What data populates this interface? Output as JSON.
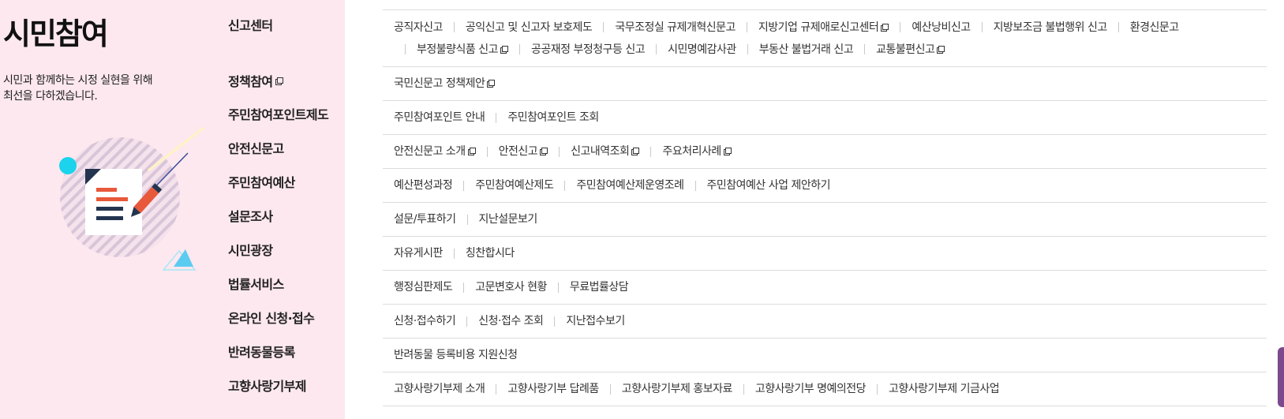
{
  "intro": {
    "title": "시민참여",
    "desc_line1": "시민과 함께하는 시정 실현을 위해",
    "desc_line2": "최선을 다하겠습니다."
  },
  "menu": [
    {
      "category": "신고센터",
      "category_external": false,
      "links": [
        {
          "label": "공직자신고",
          "external": false
        },
        {
          "label": "공익신고 및 신고자 보호제도",
          "external": false
        },
        {
          "label": "국무조정실 규제개혁신문고",
          "external": false
        },
        {
          "label": "지방기업 규제애로신고센터",
          "external": true
        },
        {
          "label": "예산낭비신고",
          "external": false
        },
        {
          "label": "지방보조금 불법행위 신고",
          "external": false
        },
        {
          "label": "환경신문고",
          "external": false
        },
        {
          "label": "부정불량식품 신고",
          "external": true
        },
        {
          "label": "공공재정 부정청구등 신고",
          "external": false
        },
        {
          "label": "시민명예감사관",
          "external": false
        },
        {
          "label": "부동산 불법거래 신고",
          "external": false
        },
        {
          "label": "교통불편신고",
          "external": true
        }
      ]
    },
    {
      "category": "정책참여",
      "category_external": true,
      "links": [
        {
          "label": "국민신문고 정책제안",
          "external": true
        }
      ]
    },
    {
      "category": "주민참여포인트제도",
      "category_external": false,
      "links": [
        {
          "label": "주민참여포인트 안내",
          "external": false
        },
        {
          "label": "주민참여포인트 조회",
          "external": false
        }
      ]
    },
    {
      "category": "안전신문고",
      "category_external": false,
      "links": [
        {
          "label": "안전신문고 소개",
          "external": true
        },
        {
          "label": "안전신고",
          "external": true
        },
        {
          "label": "신고내역조회",
          "external": true
        },
        {
          "label": "주요처리사례",
          "external": true
        }
      ]
    },
    {
      "category": "주민참여예산",
      "category_external": false,
      "links": [
        {
          "label": "예산편성과정",
          "external": false
        },
        {
          "label": "주민참여예산제도",
          "external": false
        },
        {
          "label": "주민참여예산제운영조례",
          "external": false
        },
        {
          "label": "주민참여예산 사업 제안하기",
          "external": false
        }
      ]
    },
    {
      "category": "설문조사",
      "category_external": false,
      "links": [
        {
          "label": "설문/투표하기",
          "external": false
        },
        {
          "label": "지난설문보기",
          "external": false
        }
      ]
    },
    {
      "category": "시민광장",
      "category_external": false,
      "links": [
        {
          "label": "자유게시판",
          "external": false
        },
        {
          "label": "칭찬합시다",
          "external": false
        }
      ]
    },
    {
      "category": "법률서비스",
      "category_external": false,
      "links": [
        {
          "label": "행정심판제도",
          "external": false
        },
        {
          "label": "고문변호사 현황",
          "external": false
        },
        {
          "label": "무료법률상담",
          "external": false
        }
      ]
    },
    {
      "category": "온라인 신청·접수",
      "category_external": false,
      "links": [
        {
          "label": "신청·접수하기",
          "external": false
        },
        {
          "label": "신청·접수 조회",
          "external": false
        },
        {
          "label": "지난접수보기",
          "external": false
        }
      ]
    },
    {
      "category": "반려동물등록",
      "category_external": false,
      "links": [
        {
          "label": "반려동물 등록비용 지원신청",
          "external": false
        }
      ]
    },
    {
      "category": "고향사랑기부제",
      "category_external": false,
      "links": [
        {
          "label": "고향사랑기부제 소개",
          "external": false
        },
        {
          "label": "고향사랑기부 답례품",
          "external": false
        },
        {
          "label": "고향사랑기부제 홍보자료",
          "external": false
        },
        {
          "label": "고향사랑기부 명예의전당",
          "external": false
        },
        {
          "label": "고향사랑기부제 기금사업",
          "external": false
        }
      ]
    }
  ],
  "colors": {
    "panel_bg": "#fde8ef",
    "divider": "#dcdcdc",
    "accent_red": "#e8583a",
    "accent_navy": "#23344f",
    "accent_cyan": "#1bd3ec"
  },
  "icons": {
    "external_link": "new-window-icon",
    "illustration": "document-pen-illustration"
  }
}
